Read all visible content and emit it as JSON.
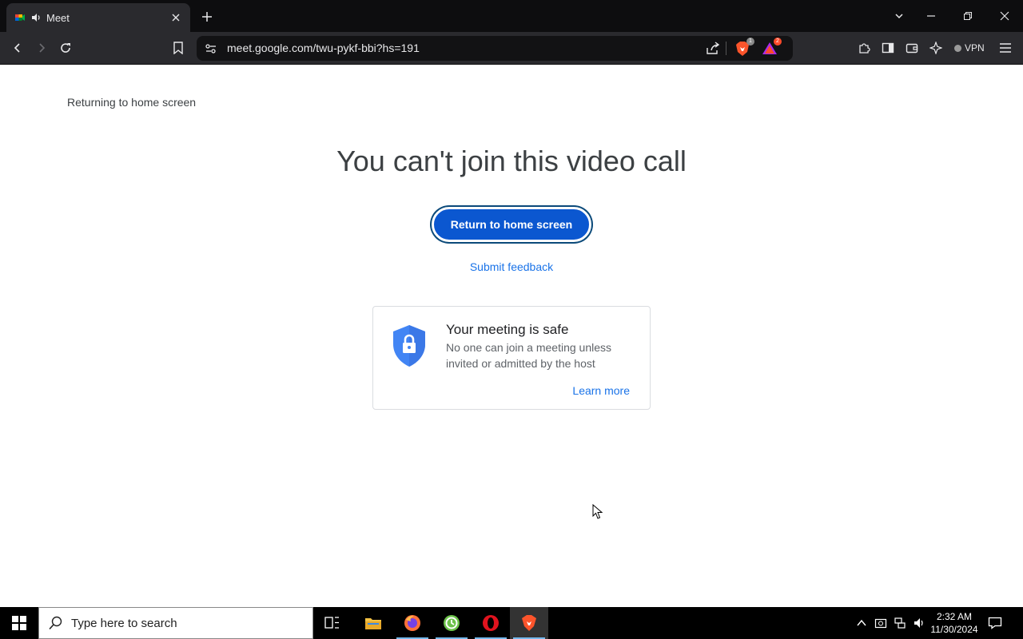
{
  "browser": {
    "tab_title": "Meet",
    "url": "meet.google.com/twu-pykf-bbi?hs=191",
    "brave_shield_count": "1",
    "rewards_count": "2",
    "vpn_label": "VPN"
  },
  "page": {
    "returning_text": "Returning to home screen",
    "headline": "You can't join this video call",
    "primary_button": "Return to home screen",
    "feedback_link": "Submit feedback",
    "safety_card": {
      "title": "Your meeting is safe",
      "body": "No one can join a meeting unless invited or admitted by the host",
      "link": "Learn more"
    }
  },
  "taskbar": {
    "search_placeholder": "Type here to search",
    "time": "2:32 AM",
    "date": "11/30/2024"
  },
  "colors": {
    "primary": "#0b57d0",
    "link": "#1a73e8",
    "shield": "#4285f4"
  }
}
